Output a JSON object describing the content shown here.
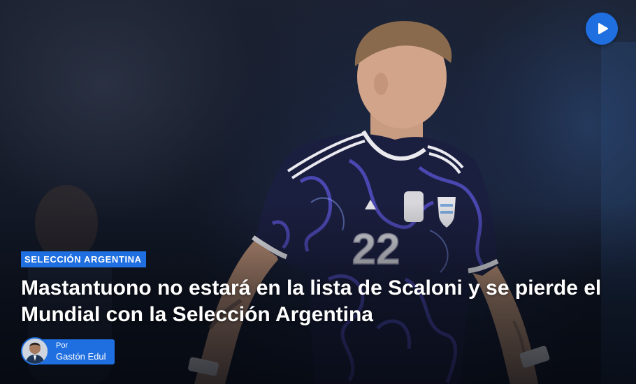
{
  "video_button": {
    "icon": "play-icon"
  },
  "article": {
    "category": "SELECCIÓN ARGENTINA",
    "headline": "Mastantuono no estará en la lista de Scaloni y se pierde el Mundial con la Selección Argentina",
    "jersey_number": "22"
  },
  "author": {
    "prefix": "Por",
    "name": "Gastón Edul"
  },
  "colors": {
    "accent": "#1f6fe0",
    "text": "#ffffff"
  }
}
